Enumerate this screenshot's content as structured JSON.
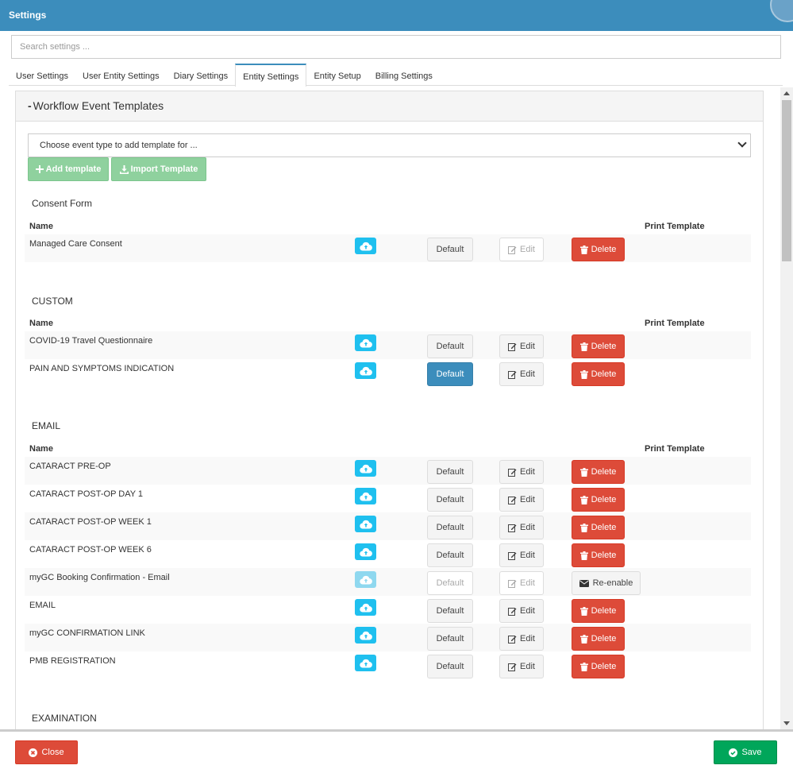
{
  "window": {
    "title": "Settings"
  },
  "search": {
    "placeholder": "Search settings ..."
  },
  "tabs": [
    {
      "label": "User Settings",
      "active": false
    },
    {
      "label": "User Entity Settings",
      "active": false
    },
    {
      "label": "Diary Settings",
      "active": false
    },
    {
      "label": "Entity Settings",
      "active": true
    },
    {
      "label": "Entity Setup",
      "active": false
    },
    {
      "label": "Billing Settings",
      "active": false
    }
  ],
  "panel": {
    "collapse_symbol": "-",
    "title": "Workflow Event Templates",
    "event_select_placeholder": "Choose event type to add template for ...",
    "add_template_label": "Add template",
    "import_template_label": "Import Template"
  },
  "columns": {
    "name": "Name",
    "print": "Print Template"
  },
  "sections": [
    {
      "title": "Consent Form",
      "rows": [
        {
          "name": "Managed Care Consent",
          "default_label": "Default",
          "edit_label": "Edit",
          "action_label": "Delete",
          "state": "edit-disabled"
        }
      ]
    },
    {
      "title": "CUSTOM",
      "rows": [
        {
          "name": "COVID-19 Travel Questionnaire",
          "default_label": "Default",
          "edit_label": "Edit",
          "action_label": "Delete",
          "state": "normal"
        },
        {
          "name": "PAIN AND SYMPTOMS INDICATION",
          "default_label": "Default",
          "edit_label": "Edit",
          "action_label": "Delete",
          "state": "default-active"
        }
      ]
    },
    {
      "title": "EMAIL",
      "rows": [
        {
          "name": "CATARACT PRE-OP",
          "default_label": "Default",
          "edit_label": "Edit",
          "action_label": "Delete",
          "state": "normal"
        },
        {
          "name": "CATARACT POST-OP DAY 1",
          "default_label": "Default",
          "edit_label": "Edit",
          "action_label": "Delete",
          "state": "normal"
        },
        {
          "name": "CATARACT POST-OP WEEK 1",
          "default_label": "Default",
          "edit_label": "Edit",
          "action_label": "Delete",
          "state": "normal"
        },
        {
          "name": "CATARACT POST-OP WEEK 6",
          "default_label": "Default",
          "edit_label": "Edit",
          "action_label": "Delete",
          "state": "normal"
        },
        {
          "name": "myGC Booking Confirmation - Email",
          "default_label": "Default",
          "edit_label": "Edit",
          "action_label": "Re-enable",
          "state": "disabled"
        },
        {
          "name": "EMAIL",
          "default_label": "Default",
          "edit_label": "Edit",
          "action_label": "Delete",
          "state": "normal"
        },
        {
          "name": "myGC CONFIRMATION LINK",
          "default_label": "Default",
          "edit_label": "Edit",
          "action_label": "Delete",
          "state": "normal"
        },
        {
          "name": "PMB REGISTRATION",
          "default_label": "Default",
          "edit_label": "Edit",
          "action_label": "Delete",
          "state": "normal"
        }
      ]
    },
    {
      "title": "EXAMINATION",
      "rows": []
    }
  ],
  "footer": {
    "close_label": "Close",
    "save_label": "Save"
  },
  "colors": {
    "header": "#3c8dbc",
    "primary": "#3c8dbc",
    "danger": "#dd4b39",
    "success": "#00a65a",
    "info": "#1fc0ef",
    "add_green": "#8fd19e"
  }
}
